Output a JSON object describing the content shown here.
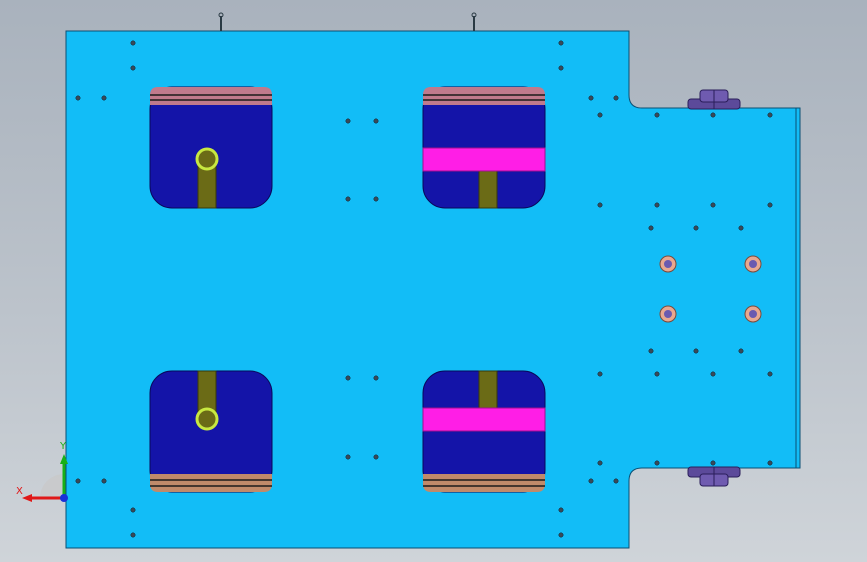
{
  "viewport": {
    "background_top": "#a9b2bd",
    "background_bottom": "#cfd4d9"
  },
  "model": {
    "plate_color": "#12bdf7",
    "plate_edge_color": "#0b4f73",
    "pocket_color": "#1414a8",
    "pocket_edge_color": "#08085a",
    "slot_color": "#6b6b16",
    "ring_color": "#c8e840",
    "clamp_color": "#ff1ee6",
    "stripe_top_color": "#c07a8c",
    "stripe_bottom_color": "#c08a6a",
    "boss_color": "#5c4a9a",
    "bushing_color": "#e8a890"
  },
  "triad": {
    "x_label": "X",
    "y_label": "Y",
    "x_color": "#e01818",
    "y_color": "#18b018",
    "z_color": "#1830d8",
    "x_icon": "x-axis-arrow-icon",
    "y_icon": "y-axis-arrow-icon",
    "z_icon": "z-axis-dot-icon"
  }
}
